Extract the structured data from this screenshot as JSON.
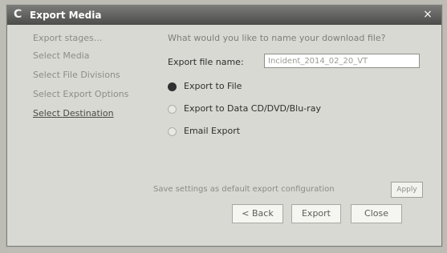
{
  "window": {
    "title": "Export Media",
    "close_glyph": "×"
  },
  "sidebar": {
    "title": "Export stages...",
    "items": [
      "Select Media",
      "Select File Divisions",
      "Select Export Options",
      "Select Destination"
    ]
  },
  "content": {
    "question": "What would you like to name your download file?",
    "file_name_label": "Export file name:",
    "file_name_value": "Incident_2014_02_20_VT",
    "options": [
      {
        "label": "Export to File",
        "selected": true
      },
      {
        "label": "Export to Data CD/DVD/Blu-ray",
        "selected": false
      },
      {
        "label": "Email Export",
        "selected": false
      }
    ],
    "default_label": "Save settings as default export configuration",
    "apply_label": "Apply"
  },
  "buttons": {
    "back": "< Back",
    "export": "Export",
    "close": "Close"
  },
  "colors": {
    "window_bg": "#d9d9d3",
    "titlebar": "#5f5f5d",
    "selected_radio": "#303030"
  }
}
